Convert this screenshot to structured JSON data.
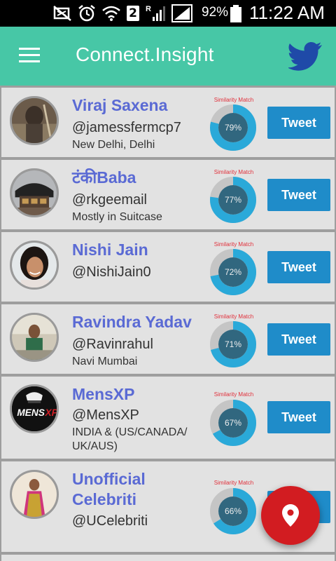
{
  "status_bar": {
    "sim_number": "2",
    "battery_percent": "92%",
    "time": "11:22 AM",
    "icons": [
      "no-notifications-icon",
      "alarm-icon",
      "wifi-icon",
      "sim-2-icon",
      "roaming-signal-icon",
      "signal-icon",
      "battery-icon"
    ]
  },
  "app_bar": {
    "title": "Connect.Insight",
    "menu_icon": "menu-icon",
    "brand_icon": "twitter-bird-icon"
  },
  "similarity_label": "Similarity Match",
  "tweet_label": "Tweet",
  "users": [
    {
      "name": "Viraj Saxena",
      "handle": "@jamessfermcp7",
      "location": "New Delhi, Delhi",
      "similarity": "79%",
      "similarity_value": 0.79
    },
    {
      "name": "टंकीBaba",
      "handle": "@rkgeemail",
      "location": "Mostly in Suitcase",
      "similarity": "77%",
      "similarity_value": 0.77
    },
    {
      "name": "Nishi Jain",
      "handle": "@NishiJain0",
      "location": "",
      "similarity": "72%",
      "similarity_value": 0.72
    },
    {
      "name": "Ravindra Yadav",
      "handle": "@Ravinrahul",
      "location": "Navi Mumbai",
      "similarity": "71%",
      "similarity_value": 0.71
    },
    {
      "name": "MensXP",
      "handle": "@MensXP",
      "location_lines": [
        "INDIA & (US/CANADA/",
        "UK/AUS)"
      ],
      "similarity": "67%",
      "similarity_value": 0.67
    },
    {
      "name_lines": [
        "Unofficial",
        "Celebriti"
      ],
      "handle": "@UCelebriti",
      "location": "",
      "similarity": "66%",
      "similarity_value": 0.66
    }
  ],
  "fab_icon": "location-pin-icon",
  "colors": {
    "app_bar": "#47c7a6",
    "name": "#5a6ad4",
    "tweet_button": "#1f8cc9",
    "similarity_ring": "#2aa9d9",
    "similarity_inner": "#31677f",
    "similarity_label": "#e0303b",
    "fab": "#d21c21"
  }
}
